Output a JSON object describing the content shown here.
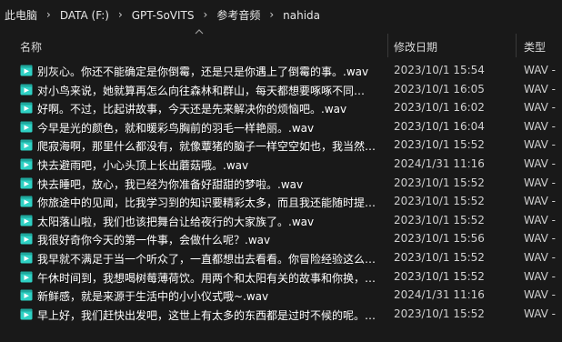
{
  "breadcrumb": [
    "此电脑",
    "DATA (F:)",
    "GPT-SoVITS",
    "参考音频",
    "nahida"
  ],
  "columns": {
    "name": "名称",
    "date": "修改日期",
    "type": "类型"
  },
  "accent": "#2fd1c4",
  "files": [
    {
      "name": "别灰心。你还不能确定是你倒霉，还是只是你遇上了倒霉的事。.wav",
      "date": "2023/10/1 15:54",
      "type": "WAV -"
    },
    {
      "name": "对小鸟来说，她就算再怎么向往森林和群山，每天都想要啄啄不同果子的味道…",
      "date": "2023/10/1 16:05",
      "type": "WAV -"
    },
    {
      "name": "好啊。不过，比起讲故事，今天还是先来解决你的烦恼吧。.wav",
      "date": "2023/10/1 16:02",
      "type": "WAV -"
    },
    {
      "name": "今早是光的颜色，就和暖彩鸟胸前的羽毛一样艳丽。.wav",
      "date": "2023/10/1 16:04",
      "type": "WAV -"
    },
    {
      "name": "爬寂海啊，那里什么都没有，就像蕈猪的脑子一样空空如也，我当然…",
      "date": "2023/10/1 15:52",
      "type": "WAV -"
    },
    {
      "name": "快去避雨吧，小心头顶上长出蘑菇哦。.wav",
      "date": "2024/1/31 11:16",
      "type": "WAV -"
    },
    {
      "name": "快去睡吧，放心，我已经为你准备好甜甜的梦啦。.wav",
      "date": "2023/10/1 15:52",
      "type": "WAV -"
    },
    {
      "name": "你旅途中的见闻，比我学习到的知识要精彩太多，而且我还能随时提…",
      "date": "2023/10/1 15:52",
      "type": "WAV -"
    },
    {
      "name": "太阳落山啦，我们也该把舞台让给夜行的大家族了。.wav",
      "date": "2023/10/1 15:52",
      "type": "WAV -"
    },
    {
      "name": "我很好奇你今天的第一件事，会做什么呢？.wav",
      "date": "2023/10/1 15:56",
      "type": "WAV -"
    },
    {
      "name": "我早就不满足于当一个听众了，一直都想出去看看。你冒险经验这么…",
      "date": "2023/10/1 15:52",
      "type": "WAV -"
    },
    {
      "name": "午休时间到，我想喝树莓薄荷饮。用两个和太阳有关的故事和你换，…",
      "date": "2023/10/1 15:52",
      "type": "WAV -"
    },
    {
      "name": "新鲜感，就是来源于生活中的小小仪式哦~.wav",
      "date": "2024/1/31 11:16",
      "type": "WAV -"
    },
    {
      "name": "早上好，我们赶快出发吧，这世上有太多的东西都是过时不候的呢。…",
      "date": "2023/10/1 15:52",
      "type": "WAV -"
    }
  ]
}
